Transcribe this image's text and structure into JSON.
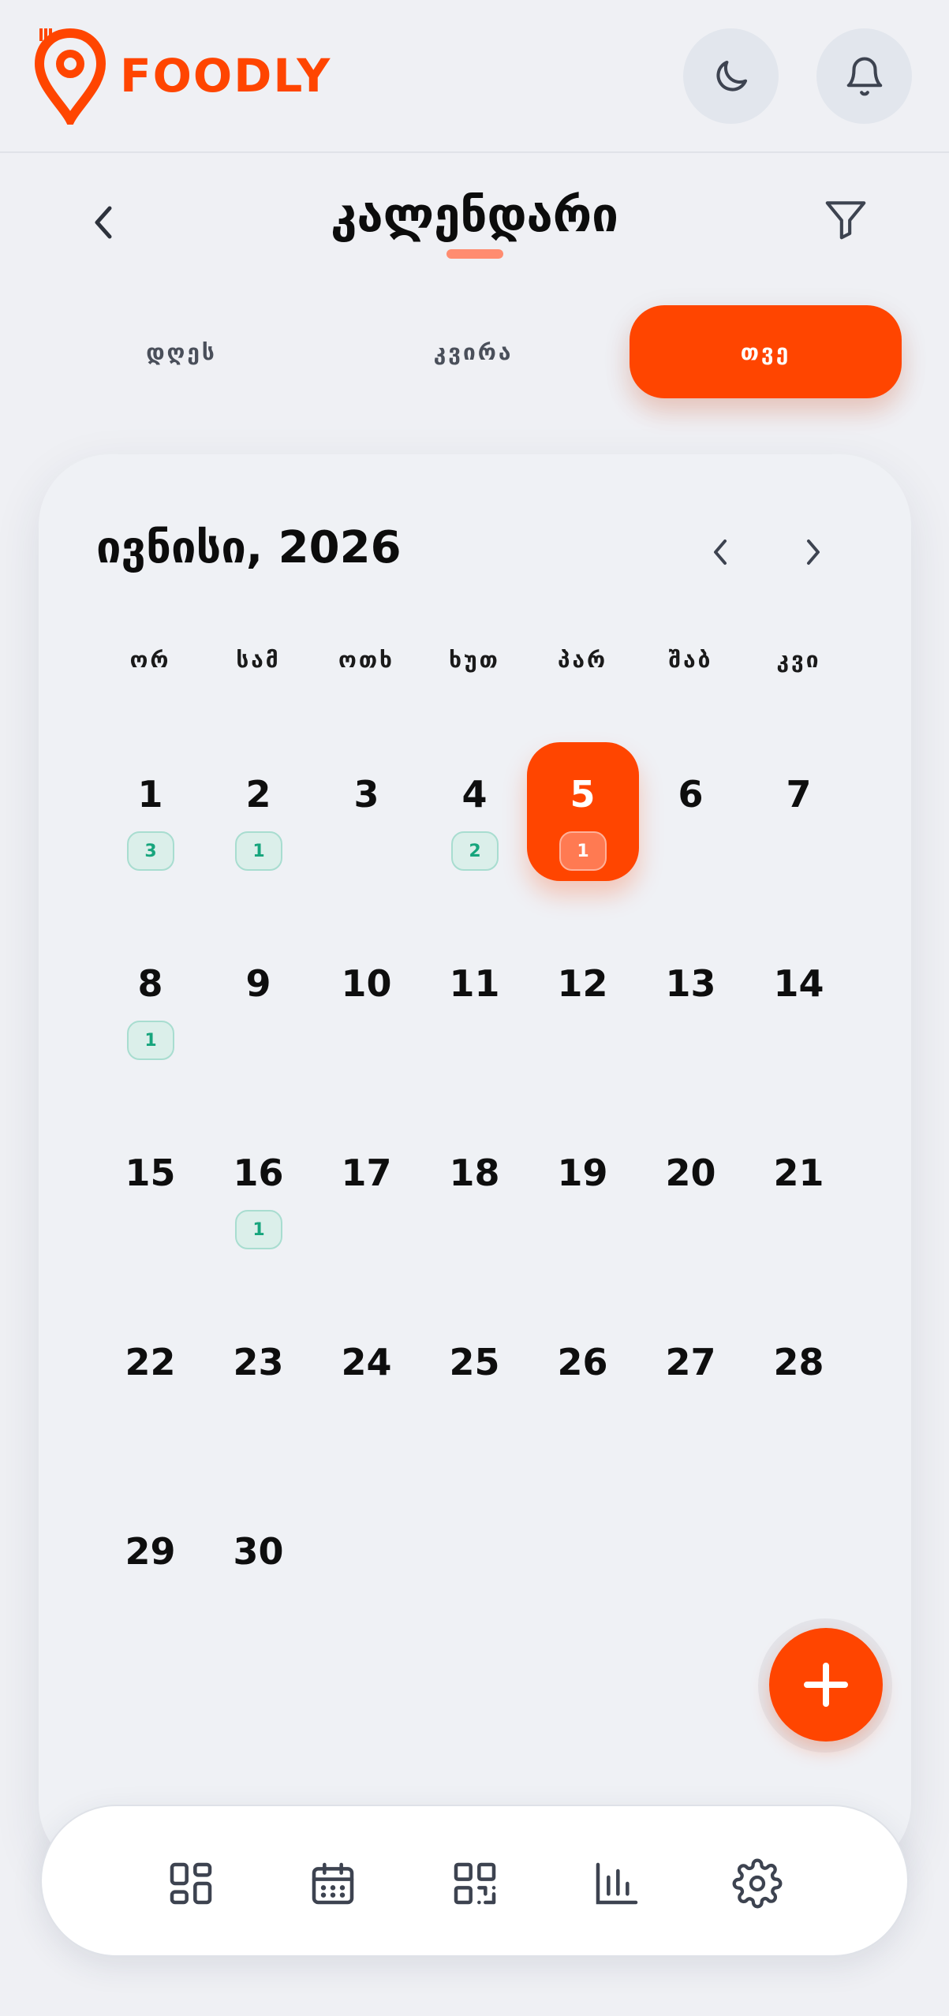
{
  "app": {
    "brand": "FOODLY",
    "brand_color": "#ff4500"
  },
  "header": {
    "title": "კალენდარი",
    "icons": {
      "theme": "moon-icon",
      "notifications": "bell-icon",
      "back": "chevron-left-icon",
      "filter": "filter-icon"
    }
  },
  "view_tabs": {
    "day": "დღეს",
    "week": "კვირა",
    "month": "თვე",
    "active": "month"
  },
  "calendar": {
    "month_label": "ივნისი, 2026",
    "weekdays": [
      "ორ",
      "სამ",
      "ოთხ",
      "ხუთ",
      "პარ",
      "შაბ",
      "კვი"
    ],
    "selected_day": "5",
    "weeks": [
      [
        {
          "d": "1",
          "n": "3"
        },
        {
          "d": "2",
          "n": "1"
        },
        {
          "d": "3"
        },
        {
          "d": "4",
          "n": "2"
        },
        {
          "d": "5",
          "n": "1"
        },
        {
          "d": "6"
        },
        {
          "d": "7"
        }
      ],
      [
        {
          "d": "8",
          "n": "1"
        },
        {
          "d": "9"
        },
        {
          "d": "10"
        },
        {
          "d": "11"
        },
        {
          "d": "12"
        },
        {
          "d": "13"
        },
        {
          "d": "14"
        }
      ],
      [
        {
          "d": "15"
        },
        {
          "d": "16",
          "n": "1"
        },
        {
          "d": "17"
        },
        {
          "d": "18"
        },
        {
          "d": "19"
        },
        {
          "d": "20"
        },
        {
          "d": "21"
        }
      ],
      [
        {
          "d": "22"
        },
        {
          "d": "23"
        },
        {
          "d": "24"
        },
        {
          "d": "25"
        },
        {
          "d": "26"
        },
        {
          "d": "27"
        },
        {
          "d": "28"
        }
      ],
      [
        {
          "d": "29"
        },
        {
          "d": "30"
        }
      ]
    ]
  },
  "fab": {
    "icon": "plus-icon"
  },
  "bottom_nav": {
    "items": [
      {
        "icon": "dashboard-icon"
      },
      {
        "icon": "calendar-icon"
      },
      {
        "icon": "qr-code-icon"
      },
      {
        "icon": "bar-chart-icon"
      },
      {
        "icon": "settings-icon"
      }
    ]
  }
}
